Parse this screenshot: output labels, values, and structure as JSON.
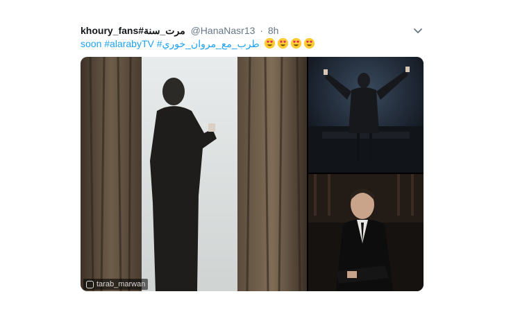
{
  "tweet": {
    "display_name": "khoury_fans#مرت_سنة",
    "handle": "@HanaNasr13",
    "separator": "·",
    "time": "8h",
    "text_prefix": "soon #alarabyTV #طرب_مع_مروان_خوري",
    "emojis": [
      "heart-eyes-emoji",
      "heart-eyes-emoji",
      "heart-eyes-emoji",
      "heart-eyes-emoji"
    ],
    "menu_icon": "chevron-down-icon",
    "photos": [
      {
        "description_icon": "photo-man-at-window"
      },
      {
        "description_icon": "photo-conductor-stage"
      },
      {
        "description_icon": "photo-man-seated-portrait"
      }
    ],
    "watermark": "tarab_marwan"
  },
  "colors": {
    "link": "#1da1f2",
    "secondary_text": "#657786"
  }
}
